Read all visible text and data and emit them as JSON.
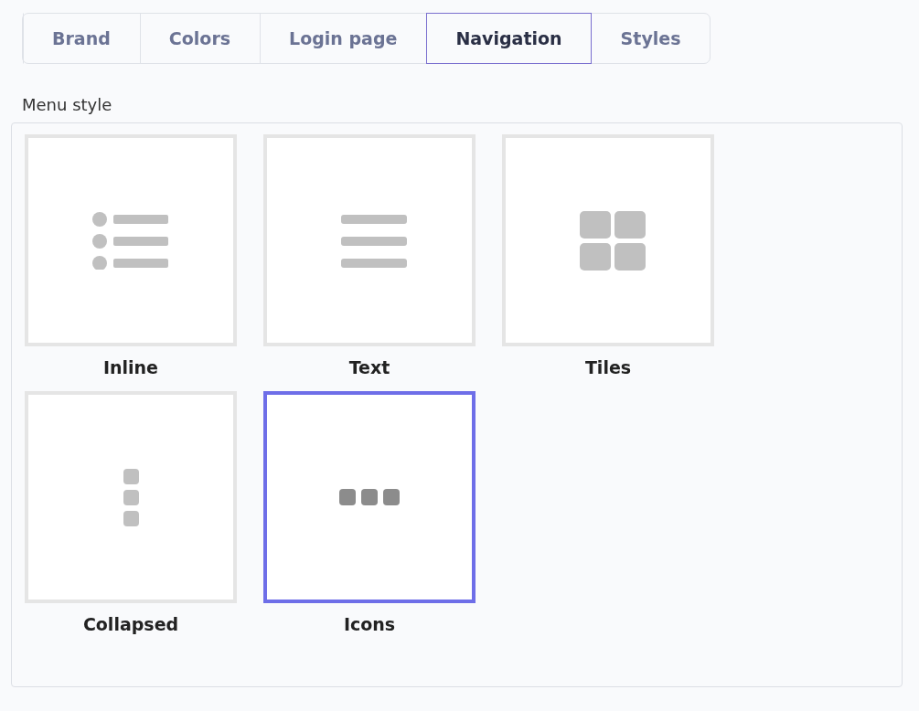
{
  "tabs": [
    {
      "label": "Brand",
      "selected": false
    },
    {
      "label": "Colors",
      "selected": false
    },
    {
      "label": "Login page",
      "selected": false
    },
    {
      "label": "Navigation",
      "selected": true
    },
    {
      "label": "Styles",
      "selected": false
    }
  ],
  "menu_style": {
    "label": "Menu style",
    "options": [
      {
        "kind": "inline",
        "label": "Inline",
        "selected": false
      },
      {
        "kind": "text",
        "label": "Text",
        "selected": false
      },
      {
        "kind": "tiles",
        "label": "Tiles",
        "selected": false
      },
      {
        "kind": "collapsed",
        "label": "Collapsed",
        "selected": false
      },
      {
        "kind": "icons",
        "label": "Icons",
        "selected": true
      }
    ]
  }
}
